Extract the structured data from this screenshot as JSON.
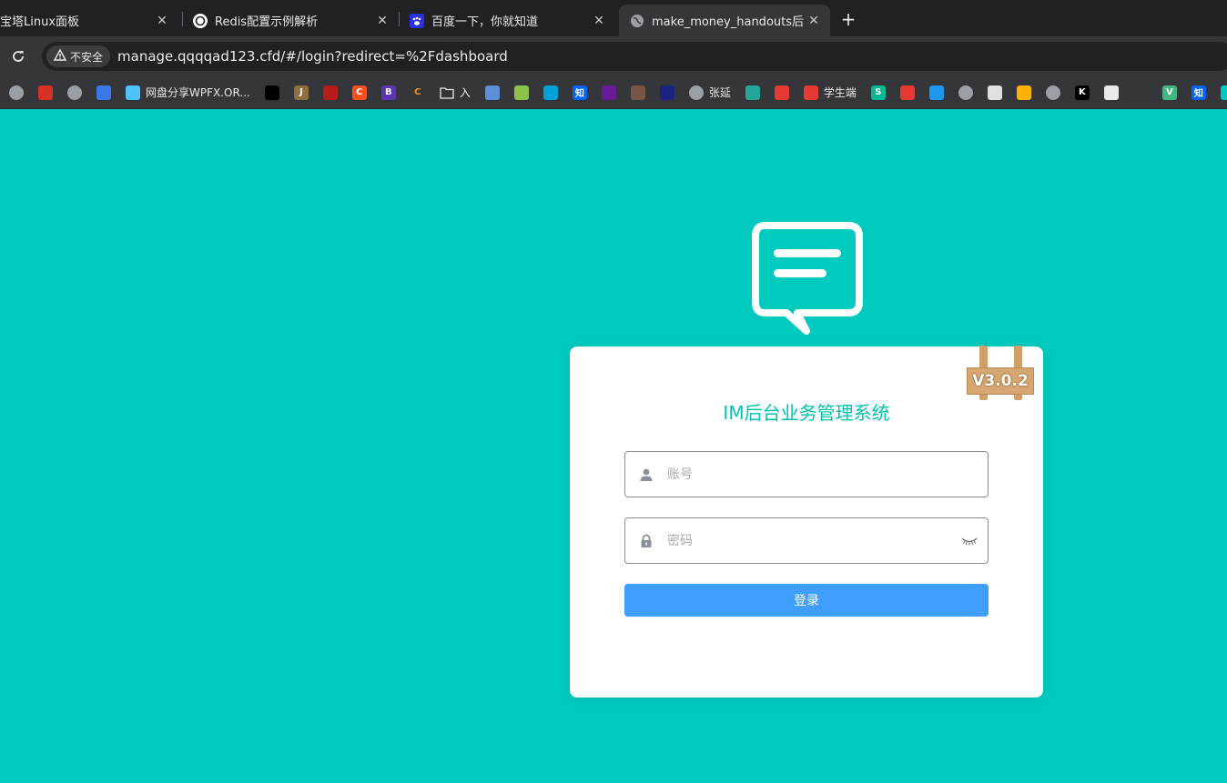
{
  "tabs": [
    {
      "title": "宝塔Linux面板",
      "active": false,
      "favicon": "globe-icon"
    },
    {
      "title": "Redis配置示例解析",
      "active": false,
      "favicon": "openai-icon"
    },
    {
      "title": "百度一下，你就知道",
      "active": false,
      "favicon": "baidu-icon"
    },
    {
      "title": "make_money_handouts后台",
      "active": true,
      "favicon": "globe-icon"
    }
  ],
  "tab_close_glyph": "✕",
  "new_tab_glyph": "+",
  "address_bar": {
    "security_label": "不安全",
    "url": "manage.qqqqad123.cfd/#/login?redirect=%2Fdashboard"
  },
  "bookmarks": [
    {
      "icon": "globe-icon",
      "label": "",
      "color": "#9aa0a6"
    },
    {
      "icon": "emblem-icon",
      "label": "",
      "color": "#d93025"
    },
    {
      "icon": "globe-icon",
      "label": "",
      "color": "#9aa0a6"
    },
    {
      "icon": "box-icon",
      "label": "",
      "color": "#3b78e7"
    },
    {
      "icon": "windmill-icon",
      "label": "网盘分享WPFX.OR...",
      "color": "#4fc3f7"
    },
    {
      "icon": "feather-icon",
      "label": "",
      "color": "#000000"
    },
    {
      "icon": "j-icon",
      "label": "",
      "color": "#8d6e3f",
      "glyph": "J"
    },
    {
      "icon": "dot-icon",
      "label": "",
      "color": "#b71c1c"
    },
    {
      "icon": "c-icon",
      "label": "",
      "color": "#f4511e",
      "glyph": "C"
    },
    {
      "icon": "b-icon",
      "label": "",
      "color": "#5e35b1",
      "glyph": "B"
    },
    {
      "icon": "c-orange-icon",
      "label": "",
      "color": "#35363a",
      "glyph": "C"
    },
    {
      "icon": "folder-icon",
      "label": "入",
      "color": "#35363a"
    },
    {
      "icon": "c-blue-icon",
      "label": "",
      "color": "#5c8fd6"
    },
    {
      "icon": "circle-icon",
      "label": "",
      "color": "#8bc34a"
    },
    {
      "icon": "tv-icon",
      "label": "",
      "color": "#00a1d6"
    },
    {
      "icon": "zhihu-icon",
      "label": "",
      "color": "#0066ff",
      "glyph": "知"
    },
    {
      "icon": "triangle-icon",
      "label": "",
      "color": "#6a1b9a"
    },
    {
      "icon": "hat-icon",
      "label": "",
      "color": "#795548"
    },
    {
      "icon": "d-icon",
      "label": "",
      "color": "#1a237e"
    },
    {
      "icon": "globe-icon",
      "label": "张延",
      "color": "#9aa0a6"
    },
    {
      "icon": "x-icon",
      "label": "",
      "color": "#26a69a"
    },
    {
      "icon": "shop-icon",
      "label": "",
      "color": "#e53935"
    },
    {
      "icon": "shield-icon",
      "label": "学生端",
      "color": "#e53935"
    },
    {
      "icon": "s-icon",
      "label": "",
      "color": "#00b894",
      "glyph": "S"
    },
    {
      "icon": "badge-icon",
      "label": "",
      "color": "#e53935"
    },
    {
      "icon": "cloud-icon",
      "label": "",
      "color": "#2196f3"
    },
    {
      "icon": "globe-icon",
      "label": "",
      "color": "#9aa0a6"
    },
    {
      "icon": "bars-icon",
      "label": "",
      "color": "#e0e0e0"
    },
    {
      "icon": "magnifier-icon",
      "label": "",
      "color": "#ffb300"
    },
    {
      "icon": "globe-icon",
      "label": "",
      "color": "#9aa0a6"
    },
    {
      "icon": "k-icon",
      "label": "",
      "color": "#000000",
      "glyph": "K"
    },
    {
      "icon": "openai-icon",
      "label": "",
      "color": "#e8eaed"
    },
    {
      "icon": "square-icon",
      "label": "",
      "color": "#35363a"
    },
    {
      "icon": "vue-icon",
      "label": "",
      "color": "#41b883",
      "glyph": "V"
    },
    {
      "icon": "zhihu-icon",
      "label": "",
      "color": "#0066ff",
      "glyph": "知"
    },
    {
      "icon": "partial-icon",
      "label": "",
      "color": "#00c9bd"
    }
  ],
  "login": {
    "version_badge": "V3.0.2",
    "title": "IM后台业务管理系统",
    "username_placeholder": "账号",
    "password_placeholder": "密码",
    "submit_label": "登录"
  },
  "colors": {
    "page_background": "#00c9bd",
    "title_color": "#00c2b3",
    "button_color": "#409eff"
  }
}
